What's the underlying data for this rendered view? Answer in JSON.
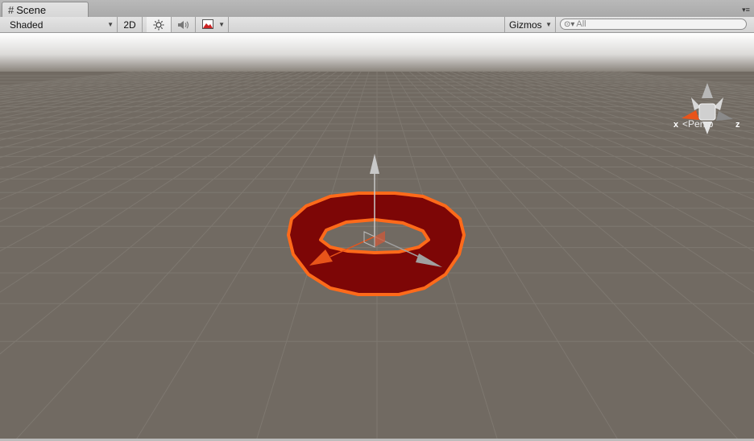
{
  "tab": {
    "title": "Scene",
    "icon": "grid-hash-icon"
  },
  "toolbar": {
    "draw_mode": "Shaded",
    "mode_2d": "2D",
    "lighting_icon": "sun-icon",
    "audio_icon": "speaker-icon",
    "effects_icon": "image-icon",
    "gizmos_label": "Gizmos",
    "search_placeholder": "All"
  },
  "view_gizmo": {
    "x_label": "x",
    "z_label": "z",
    "projection_label": "Persp"
  },
  "colors": {
    "background": "#716a62",
    "torus_fill": "#7d0606",
    "selection_outline": "#ff6a1a",
    "x_axis": "#e8541a",
    "y_axis": "#c8c8c8",
    "z_axis": "#a0a0a0"
  }
}
